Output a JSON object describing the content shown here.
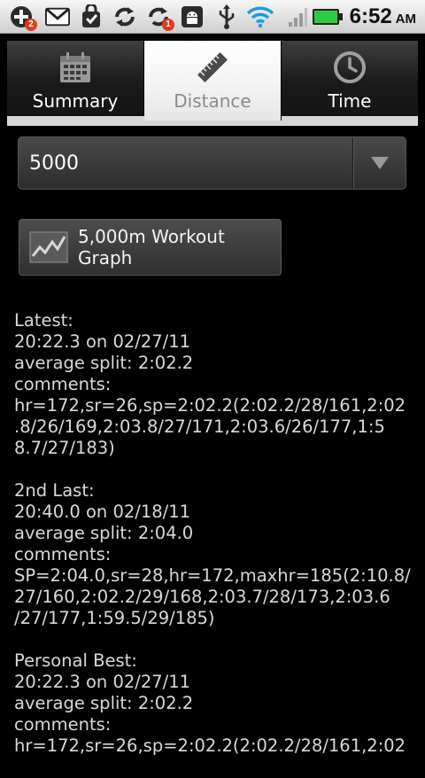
{
  "status_bar": {
    "notifications": [
      {
        "icon": "add-notification-icon",
        "badge": "2"
      },
      {
        "icon": "gmail-icon",
        "badge": ""
      },
      {
        "icon": "shopping-bag-icon",
        "badge": ""
      },
      {
        "icon": "sync-icon",
        "badge": ""
      },
      {
        "icon": "sync-error-icon",
        "badge": "1"
      },
      {
        "icon": "android-debug-icon",
        "badge": ""
      },
      {
        "icon": "usb-icon",
        "badge": ""
      }
    ],
    "system": [
      "wifi-icon",
      "signal-icon",
      "battery-icon"
    ],
    "time": "6:52",
    "ampm": "AM"
  },
  "tabs": [
    {
      "label": "Summary",
      "icon": "calendar-icon",
      "active": false
    },
    {
      "label": "Distance",
      "icon": "ruler-icon",
      "active": true
    },
    {
      "label": "Time",
      "icon": "clock-icon",
      "active": false
    }
  ],
  "spinner": {
    "value": "5000"
  },
  "graph_button": {
    "label": "5,000m Workout Graph"
  },
  "sections": [
    {
      "heading": "Latest:",
      "result": "20:22.3 on 02/27/11",
      "split": "average split: 2:02.2",
      "comments_label": "comments:",
      "comments": [
        "hr=172,sr=26,sp=2:02.2(2:02.2/28/161,2:02",
        ".8/26/169,2:03.8/27/171,2:03.6/26/177,1:5",
        "8.7/27/183)"
      ]
    },
    {
      "heading": "2nd Last:",
      "result": "20:40.0 on 02/18/11",
      "split": "average split: 2:04.0",
      "comments_label": "comments:",
      "comments": [
        "SP=2:04.0,sr=28,hr=172,maxhr=185(2:10.8/",
        "27/160,2:02.2/29/168,2:03.7/28/173,2:03.6",
        "/27/177,1:59.5/29/185)"
      ]
    },
    {
      "heading": "Personal Best:",
      "result": "20:22.3 on 02/27/11",
      "split": "average split: 2:02.2",
      "comments_label": "comments:",
      "comments": [
        "hr=172,sr=26,sp=2:02.2(2:02.2/28/161,2:02"
      ]
    }
  ],
  "colors": {
    "background": "#000000",
    "status_bar": "#e6e6e6",
    "text": "#d9d9d9",
    "battery": "#2ecc40",
    "wifi": "#1e9be0"
  }
}
